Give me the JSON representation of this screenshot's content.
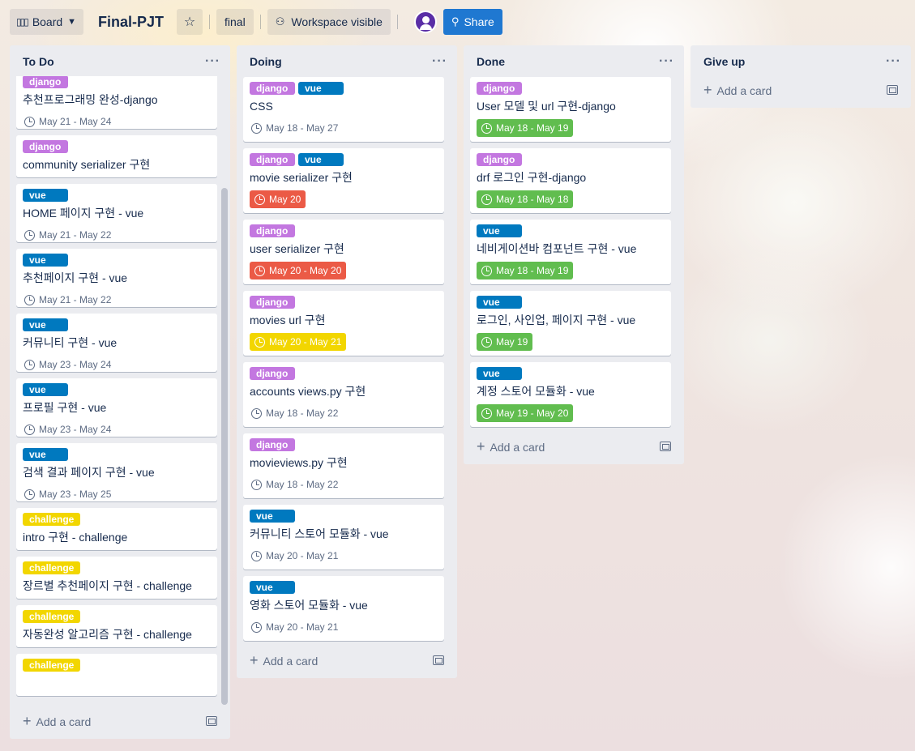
{
  "header": {
    "board_switcher": "Board",
    "board_title": "Final-PJT",
    "tag_button": "final",
    "visibility_button": "Workspace visible",
    "share_button": "Share"
  },
  "lists": [
    {
      "title": "To Do",
      "add_card": "Add a card",
      "cards": [
        {
          "labels": [
            "django"
          ],
          "title": "추천프로그래밍 완성-django",
          "due": "May 21 - May 24",
          "due_style": "none"
        },
        {
          "labels": [
            "django"
          ],
          "title": "community serializer 구현",
          "due": "",
          "due_style": "none"
        },
        {
          "labels": [
            "vue"
          ],
          "title": "HOME 페이지 구현 - vue",
          "due": "May 21 - May 22",
          "due_style": "none"
        },
        {
          "labels": [
            "vue"
          ],
          "title": "추천페이지 구현 - vue",
          "due": "May 21 - May 22",
          "due_style": "none"
        },
        {
          "labels": [
            "vue"
          ],
          "title": "커뮤니티 구현 - vue",
          "due": "May 23 - May 24",
          "due_style": "none"
        },
        {
          "labels": [
            "vue"
          ],
          "title": "프로필 구현 - vue",
          "due": "May 23 - May 24",
          "due_style": "none"
        },
        {
          "labels": [
            "vue"
          ],
          "title": "검색 결과 페이지 구현 - vue",
          "due": "May 23 - May 25",
          "due_style": "none"
        },
        {
          "labels": [
            "challenge"
          ],
          "title": "intro 구현 - challenge",
          "due": "",
          "due_style": "none"
        },
        {
          "labels": [
            "challenge"
          ],
          "title": "장르별 추천페이지 구현 - challenge",
          "due": "",
          "due_style": "none"
        },
        {
          "labels": [
            "challenge"
          ],
          "title": "자동완성 알고리즘 구현 - challenge",
          "due": "",
          "due_style": "none"
        },
        {
          "labels": [
            "challenge"
          ],
          "title": "",
          "due": "",
          "due_style": "none"
        }
      ]
    },
    {
      "title": "Doing",
      "add_card": "Add a card",
      "cards": [
        {
          "labels": [
            "django",
            "vue"
          ],
          "title": "CSS",
          "due": "May 18 - May 27",
          "due_style": "none"
        },
        {
          "labels": [
            "django",
            "vue"
          ],
          "title": "movie serializer 구현",
          "due": "May 20",
          "due_style": "red"
        },
        {
          "labels": [
            "django"
          ],
          "title": "user serializer 구현",
          "due": "May 20 - May 20",
          "due_style": "red"
        },
        {
          "labels": [
            "django"
          ],
          "title": "movies url 구현",
          "due": "May 20 - May 21",
          "due_style": "yellow"
        },
        {
          "labels": [
            "django"
          ],
          "title": "accounts views.py 구현",
          "due": "May 18 - May 22",
          "due_style": "none"
        },
        {
          "labels": [
            "django"
          ],
          "title": "movieviews.py 구현",
          "due": "May 18 - May 22",
          "due_style": "none"
        },
        {
          "labels": [
            "vue"
          ],
          "title": "커뮤니티 스토어 모듈화 - vue",
          "due": "May 20 - May 21",
          "due_style": "none"
        },
        {
          "labels": [
            "vue"
          ],
          "title": "영화 스토어 모듈화 - vue",
          "due": "May 20 - May 21",
          "due_style": "none"
        }
      ]
    },
    {
      "title": "Done",
      "add_card": "Add a card",
      "cards": [
        {
          "labels": [
            "django"
          ],
          "title": "User 모델 및 url 구현-django",
          "due": "May 18 - May 19",
          "due_style": "green"
        },
        {
          "labels": [
            "django"
          ],
          "title": "drf 로그인 구현-django",
          "due": "May 18 - May 18",
          "due_style": "green"
        },
        {
          "labels": [
            "vue"
          ],
          "title": "네비게이션바 컴포넌트 구현 - vue",
          "due": "May 18 - May 19",
          "due_style": "green"
        },
        {
          "labels": [
            "vue"
          ],
          "title": "로그인, 사인업, 페이지 구현 - vue",
          "due": "May 19",
          "due_style": "green"
        },
        {
          "labels": [
            "vue"
          ],
          "title": "계정 스토어 모듈화 - vue",
          "due": "May 19 - May 20",
          "due_style": "green"
        }
      ]
    },
    {
      "title": "Give up",
      "add_card": "Add a card",
      "cards": []
    }
  ],
  "label_colors": {
    "django": "#c377e0",
    "vue": "#0079bf",
    "challenge": "#f2d600"
  },
  "due_colors": {
    "red": "#eb5a46",
    "green": "#61bd4f",
    "yellow": "#f2d600"
  }
}
